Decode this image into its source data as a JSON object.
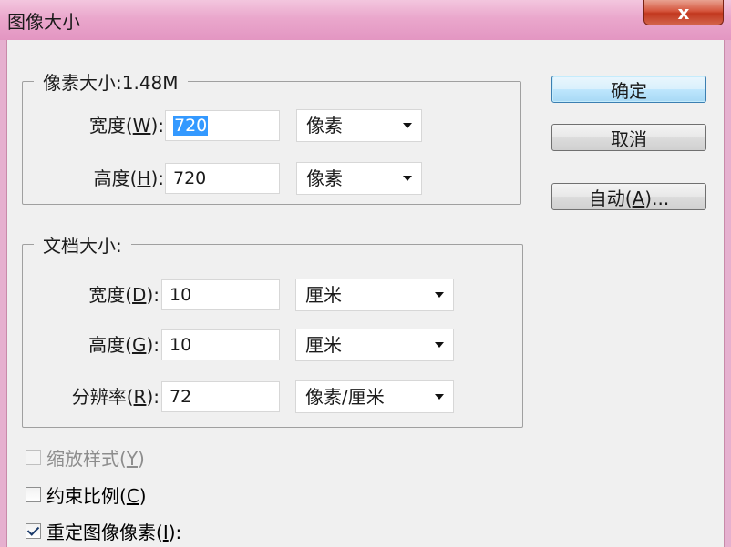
{
  "window": {
    "title": "图像大小",
    "close_glyph": "x"
  },
  "pixel_dimensions": {
    "legend": "像素大小:1.48M",
    "width": {
      "label": "宽度",
      "mnemonic": "W",
      "value": "720",
      "unit": "像素"
    },
    "height": {
      "label": "高度",
      "mnemonic": "H",
      "value": "720",
      "unit": "像素"
    }
  },
  "document_size": {
    "legend": "文档大小:",
    "width": {
      "label": "宽度",
      "mnemonic": "D",
      "value": "10",
      "unit": "厘米"
    },
    "height": {
      "label": "高度",
      "mnemonic": "G",
      "value": "10",
      "unit": "厘米"
    },
    "resolution": {
      "label": "分辨率",
      "mnemonic": "R",
      "value": "72",
      "unit": "像素/厘米"
    }
  },
  "buttons": {
    "ok": "确定",
    "cancel": "取消",
    "auto": {
      "label": "自动",
      "mnemonic": "A",
      "suffix": "..."
    }
  },
  "options": {
    "scale_styles": {
      "label": "缩放样式",
      "mnemonic": "Y",
      "checked": false,
      "disabled": true
    },
    "constrain": {
      "label": "约束比例",
      "mnemonic": "C",
      "checked": false,
      "disabled": false
    },
    "resample": {
      "label": "重定图像像素",
      "mnemonic": "I",
      "suffix": ":",
      "checked": true,
      "disabled": false
    }
  }
}
